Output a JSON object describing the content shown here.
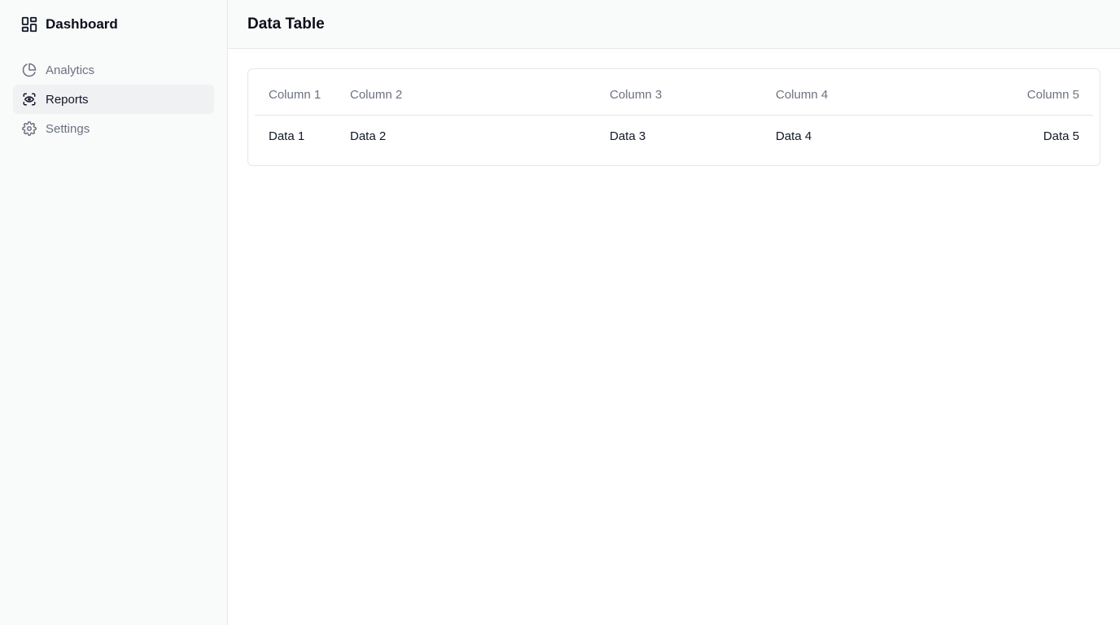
{
  "sidebar": {
    "brand": "Dashboard",
    "items": [
      {
        "label": "Analytics",
        "icon": "pie-chart-icon",
        "active": false
      },
      {
        "label": "Reports",
        "icon": "eye-report-icon",
        "active": true
      },
      {
        "label": "Settings",
        "icon": "gear-icon",
        "active": false
      }
    ]
  },
  "header": {
    "title": "Data Table"
  },
  "table": {
    "columns": [
      "Column 1",
      "Column 2",
      "Column 3",
      "Column 4",
      "Column 5"
    ],
    "rows": [
      [
        "Data 1",
        "Data 2",
        "Data 3",
        "Data 4",
        "Data 5"
      ]
    ]
  },
  "colors": {
    "sidebar_bg": "#f9fafa",
    "active_item_bg": "#f0f1f3",
    "border": "#e5e7eb",
    "muted_text": "#6b7280"
  }
}
